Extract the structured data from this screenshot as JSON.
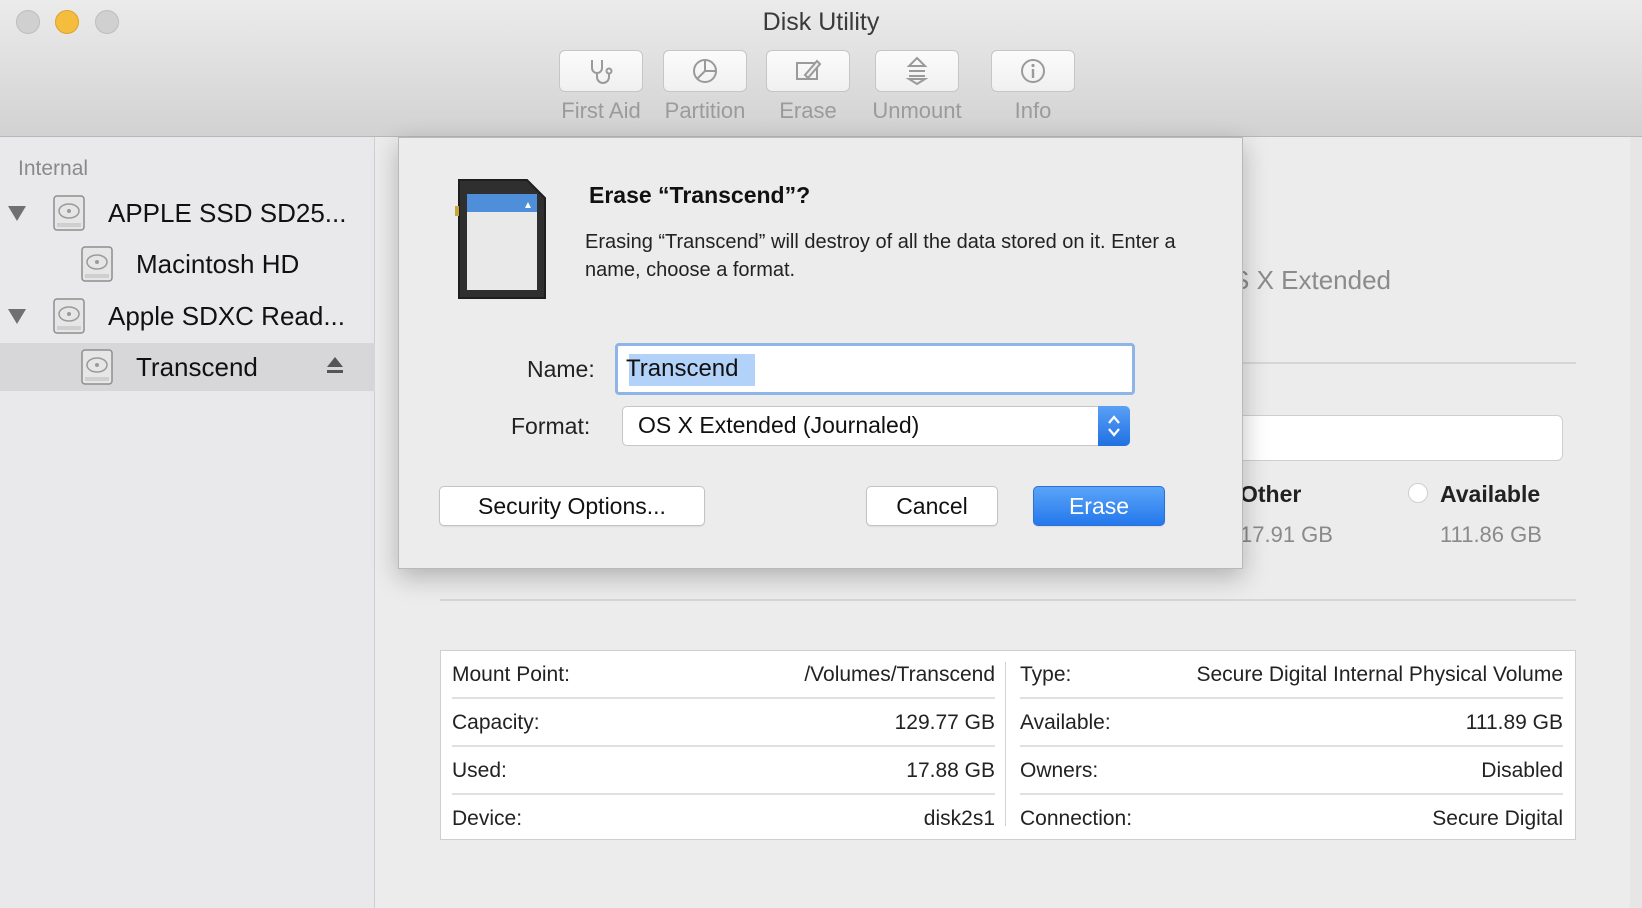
{
  "window": {
    "title": "Disk Utility"
  },
  "toolbar": {
    "items": [
      {
        "label": "First Aid",
        "icon": "stethoscope-icon"
      },
      {
        "label": "Partition",
        "icon": "pie-chart-icon"
      },
      {
        "label": "Erase",
        "icon": "erase-pencil-icon"
      },
      {
        "label": "Unmount",
        "icon": "unmount-icon"
      },
      {
        "label": "Info",
        "icon": "info-icon"
      }
    ]
  },
  "sidebar": {
    "header": "Internal",
    "items": [
      {
        "label": "APPLE SSD SD25...",
        "icon": "hard-disk-icon",
        "level": 0,
        "expanded": true
      },
      {
        "label": "Macintosh HD",
        "icon": "hard-disk-icon",
        "level": 1
      },
      {
        "label": "Apple SDXC Read...",
        "icon": "hard-disk-icon",
        "level": 0,
        "expanded": true
      },
      {
        "label": "Transcend",
        "icon": "hard-disk-icon",
        "level": 1,
        "selected": true,
        "eject": "eject-icon"
      }
    ]
  },
  "main": {
    "format_partial": "S X Extended",
    "legend": [
      {
        "title": "Other",
        "value": "17.91 GB"
      },
      {
        "title": "Available",
        "value": "111.86 GB"
      }
    ],
    "info": {
      "left": [
        {
          "key": "Mount Point:",
          "value": "/Volumes/Transcend"
        },
        {
          "key": "Capacity:",
          "value": "129.77 GB"
        },
        {
          "key": "Used:",
          "value": "17.88 GB"
        },
        {
          "key": "Device:",
          "value": "disk2s1"
        }
      ],
      "right": [
        {
          "key": "Type:",
          "value": "Secure Digital Internal Physical Volume"
        },
        {
          "key": "Available:",
          "value": "111.89 GB"
        },
        {
          "key": "Owners:",
          "value": "Disabled"
        },
        {
          "key": "Connection:",
          "value": "Secure Digital"
        }
      ]
    }
  },
  "sheet": {
    "icon": "sd-card-icon",
    "title": "Erase “Transcend”?",
    "message": "Erasing “Transcend” will destroy of all the data stored on it. Enter a name, choose a format.",
    "name_label": "Name:",
    "name_value": "Transcend",
    "format_label": "Format:",
    "format_value": "OS X Extended (Journaled)",
    "security_button": "Security Options...",
    "cancel_button": "Cancel",
    "erase_button": "Erase"
  },
  "colors": {
    "accent": "#2478ec",
    "focus_ring": "#8fb4e8",
    "selection": "#b2d2f9",
    "sidebar_selected": "#d7d7da"
  }
}
